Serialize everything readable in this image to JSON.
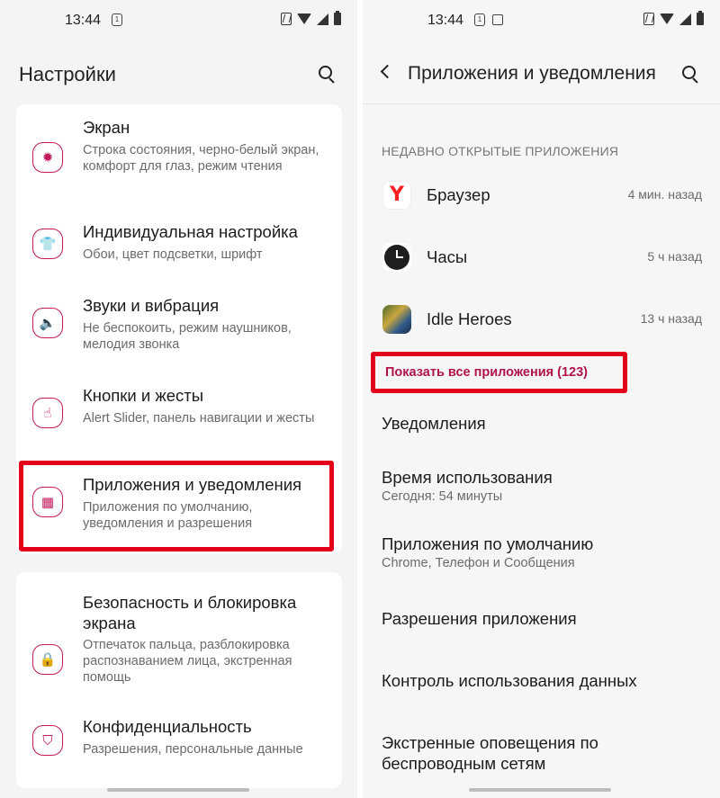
{
  "left": {
    "status": {
      "time": "13:44",
      "indicator": "1"
    },
    "title": "Настройки",
    "items": [
      {
        "title": "Экран",
        "subtitle": "Строка состояния, черно-белый экран, комфорт для глаз, режим чтения",
        "icon": "brightness-icon"
      },
      {
        "title": "Индивидуальная настройка",
        "subtitle": "Обои, цвет подсветки, шрифт",
        "icon": "tshirt-icon"
      },
      {
        "title": "Звуки и вибрация",
        "subtitle": "Не беспокоить, режим наушников, мелодия звонка",
        "icon": "speaker-icon"
      },
      {
        "title": "Кнопки и жесты",
        "subtitle": "Alert Slider, панель навигации и жесты",
        "icon": "gesture-icon"
      },
      {
        "title": "Приложения и уведомления",
        "subtitle": "Приложения по умолчанию, уведомления и разрешения",
        "icon": "apps-grid-icon"
      },
      {
        "title": "Безопасность и блокировка экрана",
        "subtitle": "Отпечаток пальца, разблокировка распознаванием лица, экстренная помощь",
        "icon": "lock-icon"
      },
      {
        "title": "Конфиденциальность",
        "subtitle": "Разрешения, персональные данные",
        "icon": "privacy-shield-icon"
      }
    ]
  },
  "right": {
    "status": {
      "time": "13:44",
      "indicator": "1"
    },
    "title": "Приложения и уведомления",
    "section_label": "НЕДАВНО ОТКРЫТЫЕ ПРИЛОЖЕНИЯ",
    "recent_apps": [
      {
        "name": "Браузер",
        "time": "4 мин. назад",
        "icon_letter": "Y"
      },
      {
        "name": "Часы",
        "time": "5 ч назад"
      },
      {
        "name": "Idle Heroes",
        "time": "13 ч назад"
      }
    ],
    "show_all": "Показать все приложения (123)",
    "items": [
      {
        "title": "Уведомления",
        "subtitle": ""
      },
      {
        "title": "Время использования",
        "subtitle": "Сегодня: 54 минуты"
      },
      {
        "title": "Приложения по умолчанию",
        "subtitle": "Chrome, Телефон и Сообщения"
      },
      {
        "title": "Разрешения приложения",
        "subtitle": ""
      },
      {
        "title": "Контроль использования данных",
        "subtitle": ""
      },
      {
        "title": "Экстренные оповещения по беспроводным сетям",
        "subtitle": ""
      }
    ]
  },
  "colors": {
    "accent": "#c2185b",
    "highlight": "#e3001b",
    "link": "#b0124c"
  }
}
